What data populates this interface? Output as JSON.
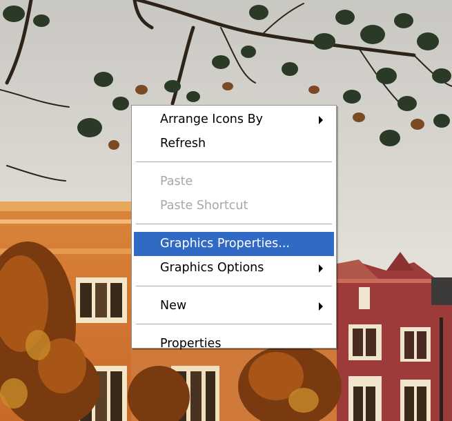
{
  "context_menu": {
    "items": [
      {
        "label": "Arrange Icons By",
        "submenu": true,
        "disabled": false
      },
      {
        "label": "Refresh",
        "submenu": false,
        "disabled": false
      },
      {
        "label": "Paste",
        "submenu": false,
        "disabled": true
      },
      {
        "label": "Paste Shortcut",
        "submenu": false,
        "disabled": true
      },
      {
        "label": "Graphics Properties...",
        "submenu": false,
        "disabled": false,
        "highlighted": true
      },
      {
        "label": "Graphics Options",
        "submenu": true,
        "disabled": false
      },
      {
        "label": "New",
        "submenu": true,
        "disabled": false
      },
      {
        "label": "Properties",
        "submenu": false,
        "disabled": false
      }
    ],
    "highlight_color": "#316ac5",
    "disabled_text_color": "#a7a6aa"
  },
  "desktop": {
    "wallpaper": "campus building with autumn tree"
  }
}
